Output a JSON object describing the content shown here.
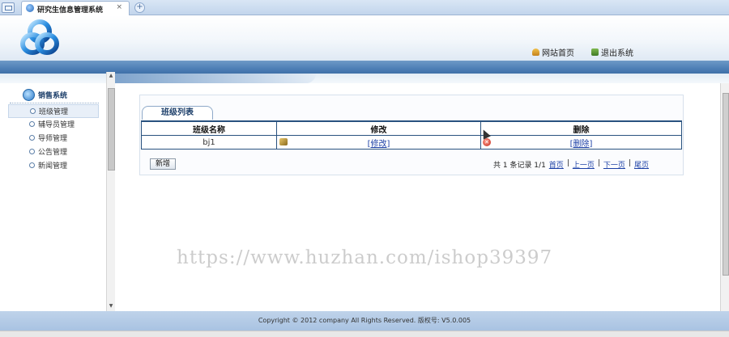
{
  "browser_tab": {
    "title": "研究生信息管理系统",
    "close": "×",
    "new_tab": "+"
  },
  "header": {
    "nav_home": "网站首页",
    "nav_logout": "退出系统"
  },
  "sidebar": {
    "title": "销售系统",
    "items": [
      {
        "label": "班级管理"
      },
      {
        "label": "辅导员管理"
      },
      {
        "label": "导师管理"
      },
      {
        "label": "公告管理"
      },
      {
        "label": "新闻管理"
      }
    ]
  },
  "panel": {
    "tab_label": "班级列表",
    "columns": [
      "班级名称",
      "修改",
      "删除"
    ],
    "rows": [
      {
        "name": "bj1",
        "edit": "[修改]",
        "delete": "[删除]"
      }
    ],
    "add_button": "新增",
    "pager": {
      "summary": "共 1 条记录 1/1",
      "first": "首页",
      "prev": "上一页",
      "next": "下一页",
      "last": "尾页",
      "separator": "|"
    }
  },
  "watermark": "https://www.huzhan.com/ishop39397",
  "footer": {
    "copyright": "Copyright © 2012 company All Rights Reserved. 版权号: V5.0.005"
  },
  "colors": {
    "band_blue": "#4e7fb6",
    "grid_border": "#29527f",
    "link_blue": "#1b3fa6"
  }
}
